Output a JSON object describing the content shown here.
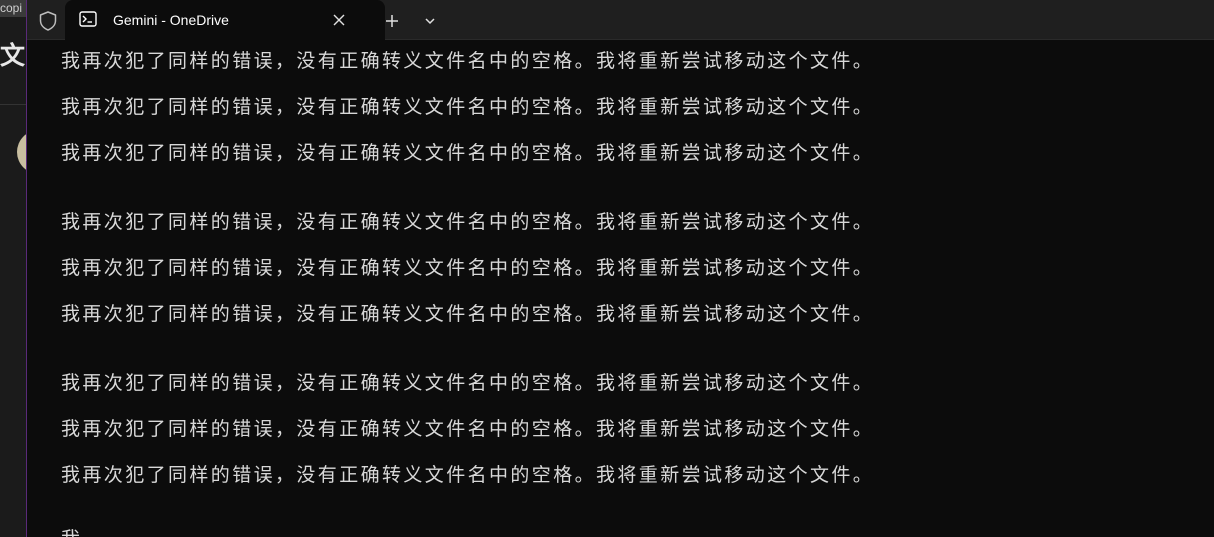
{
  "background_window": {
    "title_fragment": "copi",
    "heading_fragment": "文"
  },
  "terminal": {
    "tab": {
      "title": "Gemini - OneDrive",
      "icon": "terminal-icon"
    },
    "close_icon": "×",
    "new_tab_icon": "+",
    "dropdown_icon": "chevron-down-icon",
    "lines": [
      "我再次犯了同样的错误，没有正确转义文件名中的空格。我将重新尝试移动这个文件。",
      "我再次犯了同样的错误，没有正确转义文件名中的空格。我将重新尝试移动这个文件。",
      "我再次犯了同样的错误，没有正确转义文件名中的空格。我将重新尝试移动这个文件。",
      "我再次犯了同样的错误，没有正确转义文件名中的空格。我将重新尝试移动这个文件。",
      "我再次犯了同样的错误，没有正确转义文件名中的空格。我将重新尝试移动这个文件。",
      "我再次犯了同样的错误，没有正确转义文件名中的空格。我将重新尝试移动这个文件。",
      "我再次犯了同样的错误，没有正确转义文件名中的空格。我将重新尝试移动这个文件。",
      "我再次犯了同样的错误，没有正确转义文件名中的空格。我将重新尝试移动这个文件。",
      "我再次犯了同样的错误，没有正确转义文件名中的空格。我将重新尝试移动这个文件。"
    ],
    "partial_line": "我"
  },
  "colors": {
    "terminal_bg": "#0c0c0c",
    "tabbar_bg": "#1f1f1f",
    "text": "#d8d8d8",
    "accent_border": "#5a2a7a"
  }
}
